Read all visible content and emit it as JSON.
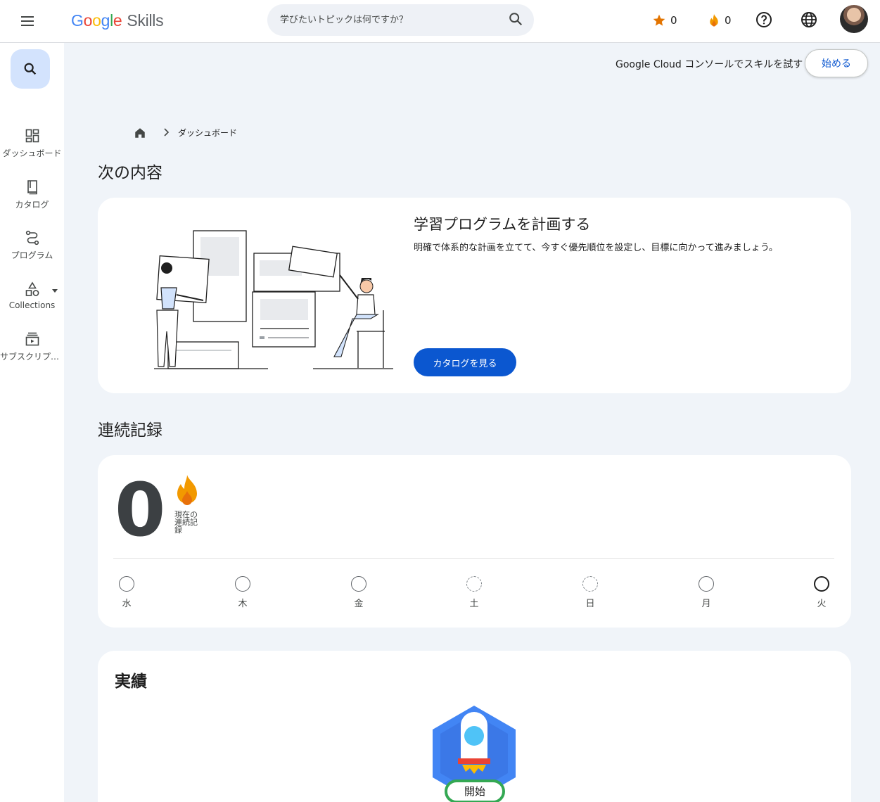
{
  "header": {
    "logo_google": "Google",
    "logo_product": "Skills",
    "search_placeholder": "学びたいトピックは何ですか？",
    "stars_count": "0",
    "streak_count": "0",
    "icons": [
      "menu-icon",
      "search-icon",
      "star-icon",
      "flame-icon",
      "help-icon",
      "globe-icon"
    ]
  },
  "rail": {
    "items": [
      {
        "label": "ダッシュボード",
        "icon": "dashboard-icon"
      },
      {
        "label": "カタログ",
        "icon": "book-icon"
      },
      {
        "label": "プログラム",
        "icon": "route-icon"
      },
      {
        "label": "Collections",
        "icon": "shapes-icon"
      },
      {
        "label": "サブスクリプション",
        "icon": "subscriptions-icon"
      }
    ]
  },
  "console_bar": {
    "text": "Google Cloud コンソールでスキルを試す",
    "button": "始める"
  },
  "breadcrumb": {
    "current": "ダッシュボード"
  },
  "next_section": {
    "heading": "次の内容",
    "card_title": "学習プログラムを計画する",
    "card_desc": "明確で体系的な計画を立てて、今すぐ優先順位を設定し、目標に向かって進みましょう。",
    "button": "カタログを見る"
  },
  "streak_section": {
    "heading": "連続記録",
    "current_value": "0",
    "current_label": "現在の連続記録",
    "days": [
      {
        "label": "水",
        "state": "empty"
      },
      {
        "label": "木",
        "state": "empty"
      },
      {
        "label": "金",
        "state": "empty"
      },
      {
        "label": "土",
        "state": "dashed"
      },
      {
        "label": "日",
        "state": "dashed"
      },
      {
        "label": "月",
        "state": "empty"
      },
      {
        "label": "火",
        "state": "today"
      }
    ]
  },
  "achievements": {
    "heading": "実績",
    "badge_label": "開始"
  },
  "colors": {
    "primary": "#0b57d0",
    "rail_active": "#d3e3fd",
    "star": "#e37400",
    "flame": "#f29900",
    "badge_blue": "#4285f4",
    "badge_ring": "#34a853"
  }
}
